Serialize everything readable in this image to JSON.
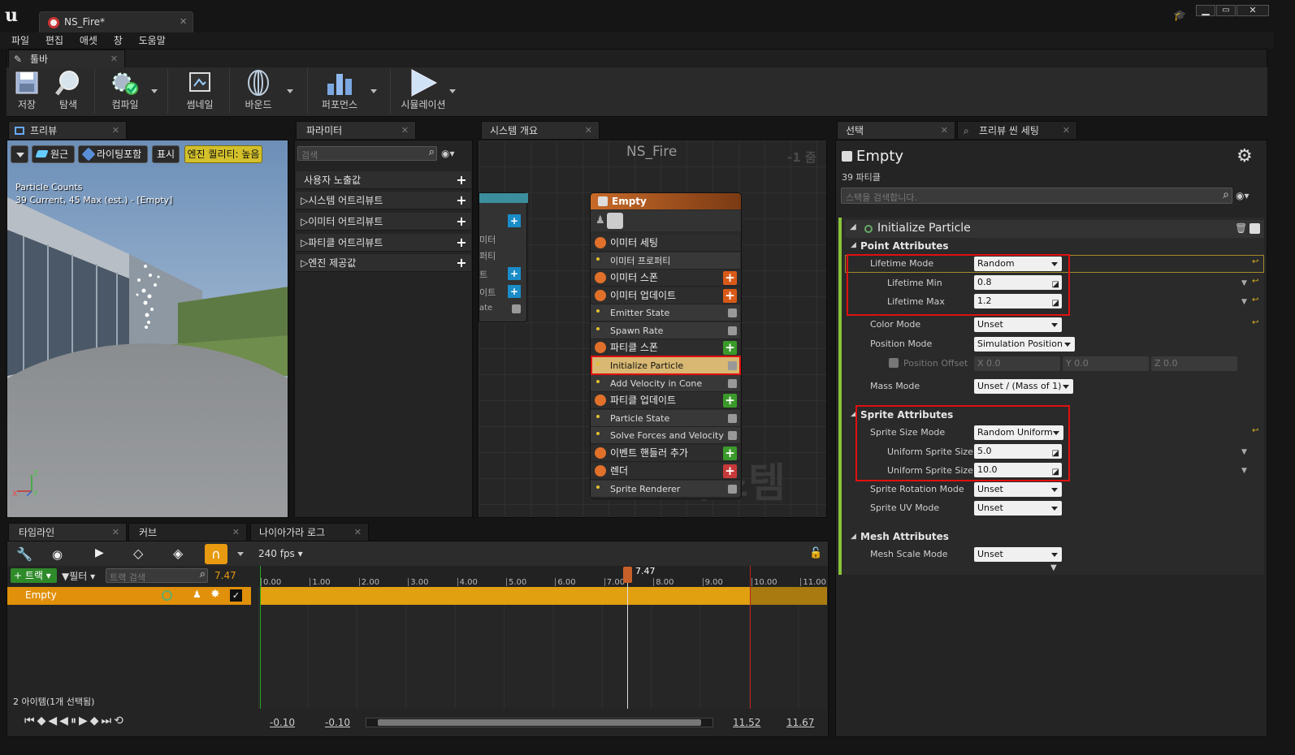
{
  "window": {
    "tab_title": "NS_Fire*"
  },
  "menu": [
    "파일",
    "편집",
    "애셋",
    "창",
    "도움말"
  ],
  "toolbar": {
    "tab_label": "툴바",
    "buttons": [
      "저장",
      "탐색",
      "컴파일",
      "썸네일",
      "바운드",
      "퍼포먼스",
      "시뮬레이션"
    ]
  },
  "preview": {
    "tab_label": "프리뷰",
    "perspective_label": "원근",
    "lighting_label": "라이팅포함",
    "show_label": "표시",
    "quality_label": "엔진 퀄리티: 높음",
    "stats_title": "Particle Counts",
    "stats_line": "39 Current, 45 Max (est.) - [Empty]"
  },
  "params": {
    "tab_label": "파라미터",
    "search_placeholder": "검색",
    "rows": [
      "사용자 노출값",
      "시스템 어트리뷰트",
      "이미터 어트리뷰트",
      "파티클 어트리뷰트",
      "엔진 제공값"
    ]
  },
  "system": {
    "tab_label": "시스템 개요",
    "title": "NS_Fire",
    "zoom": "-1 줌",
    "watermark": "시스템",
    "left_node_rows": [
      "미터",
      "퍼티",
      "트",
      "이트",
      "ate"
    ],
    "node": {
      "title": "Empty",
      "rows": [
        {
          "label": "이미터 세팅",
          "type": "hdr"
        },
        {
          "label": "이미터 프로퍼티",
          "type": "row"
        },
        {
          "label": "이미터 스폰",
          "type": "hdr",
          "add": "orange"
        },
        {
          "label": "이미터 업데이트",
          "type": "hdr",
          "add": "orange"
        },
        {
          "label": "Emitter State",
          "type": "row",
          "check": true
        },
        {
          "label": "Spawn Rate",
          "type": "row",
          "check": true
        },
        {
          "label": "파티클 스폰",
          "type": "hdr",
          "add": "green"
        },
        {
          "label": "Initialize Particle",
          "type": "row",
          "check": true,
          "selected": true
        },
        {
          "label": "Add Velocity in Cone",
          "type": "row",
          "check": true
        },
        {
          "label": "파티클 업데이트",
          "type": "hdr",
          "add": "green"
        },
        {
          "label": "Particle State",
          "type": "row",
          "check": true
        },
        {
          "label": "Solve Forces and Velocity",
          "type": "row",
          "check": true
        },
        {
          "label": "이벤트 핸들러 추가",
          "type": "hdr",
          "add": "green"
        },
        {
          "label": "렌더",
          "type": "hdr",
          "add": "red"
        },
        {
          "label": "Sprite Renderer",
          "type": "row",
          "check": true
        }
      ]
    }
  },
  "selection": {
    "tab_label": "선택",
    "tab2_label": "프리뷰 씬 세팅",
    "emitter_name": "Empty",
    "particle_count": "39 파티클",
    "search_placeholder": "스택을 검색합니다.",
    "module_title": "Initialize Particle",
    "point_section": "Point Attributes",
    "sprite_section": "Sprite Attributes",
    "mesh_section": "Mesh Attributes",
    "fields": {
      "lifetime_mode": {
        "label": "Lifetime Mode",
        "value": "Random"
      },
      "lifetime_min": {
        "label": "Lifetime Min",
        "value": "0.8"
      },
      "lifetime_max": {
        "label": "Lifetime Max",
        "value": "1.2"
      },
      "color_mode": {
        "label": "Color Mode",
        "value": "Unset"
      },
      "position_mode": {
        "label": "Position Mode",
        "value": "Simulation Position"
      },
      "position_offset": {
        "label": "Position Offset",
        "x": "X 0.0",
        "y": "Y 0.0",
        "z": "Z 0.0"
      },
      "mass_mode": {
        "label": "Mass Mode",
        "value": "Unset / (Mass of 1)"
      },
      "sprite_size_mode": {
        "label": "Sprite Size Mode",
        "value": "Random Uniform"
      },
      "uniform_size_1": {
        "label": "Uniform Sprite Size",
        "value": "5.0"
      },
      "uniform_size_2": {
        "label": "Uniform Sprite Size",
        "value": "10.0"
      },
      "sprite_rotation_mode": {
        "label": "Sprite Rotation Mode",
        "value": "Unset"
      },
      "sprite_uv_mode": {
        "label": "Sprite UV Mode",
        "value": "Unset"
      },
      "mesh_scale_mode": {
        "label": "Mesh Scale Mode",
        "value": "Unset"
      }
    }
  },
  "timeline": {
    "tab_label": "타임라인",
    "curve_tab": "커브",
    "log_tab": "나이아가라 로그",
    "fps": "240 fps",
    "track_button": "트랙",
    "filter_button": "필터",
    "search_placeholder": "트랙 검색",
    "current_time": "7.47",
    "playhead_label": "7.47",
    "track_name": "Empty",
    "ticks": [
      "0.00",
      "1.00",
      "2.00",
      "3.00",
      "4.00",
      "5.00",
      "6.00",
      "7.00",
      "8.00",
      "9.00",
      "10.00",
      "11.00"
    ],
    "item_count": "2 아이템(1개 선택됨)",
    "range": [
      "-0.10",
      "-0.10",
      "11.52",
      "11.67"
    ]
  }
}
